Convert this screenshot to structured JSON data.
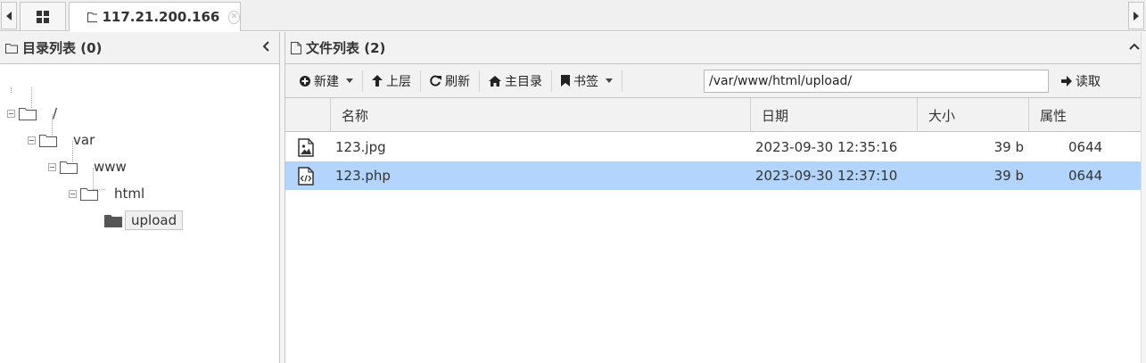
{
  "tabs": {
    "home_icon": "grid-icon",
    "host": {
      "label": "117.21.200.166",
      "icon": "folder-icon"
    }
  },
  "left_panel": {
    "title": "目录列表 (0)",
    "tree": [
      {
        "label": "/",
        "depth": 0
      },
      {
        "label": "var",
        "depth": 1
      },
      {
        "label": "www",
        "depth": 2
      },
      {
        "label": "html",
        "depth": 3
      },
      {
        "label": "upload",
        "depth": 4,
        "selected": true
      }
    ]
  },
  "right_panel": {
    "title": "文件列表 (2)",
    "toolbar": {
      "new_label": "新建",
      "up_label": "上层",
      "refresh_label": "刷新",
      "home_label": "主目录",
      "bookmark_label": "书签",
      "path_value": "/var/www/html/upload/",
      "read_label": "读取"
    },
    "columns": {
      "name": "名称",
      "date": "日期",
      "size": "大小",
      "attr": "属性"
    },
    "files": [
      {
        "name": "123.jpg",
        "date": "2023-09-30 12:35:16",
        "size": "39 b",
        "attr": "0644",
        "icon": "image-file-icon"
      },
      {
        "name": "123.php",
        "date": "2023-09-30 12:37:10",
        "size": "39 b",
        "attr": "0644",
        "icon": "code-file-icon",
        "selected": true
      }
    ]
  },
  "colors": {
    "selection": "#b3d4fc",
    "header_bg": "#f2f2f2",
    "border": "#c5c5c5"
  }
}
